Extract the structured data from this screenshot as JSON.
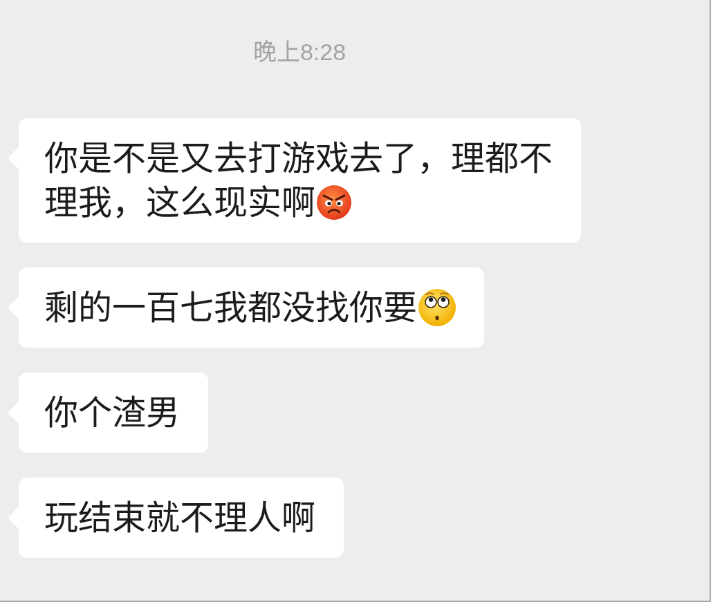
{
  "timestamp": "晚上8:28",
  "messages": [
    {
      "lines": [
        [
          {
            "kind": "text",
            "text": "你是不是又去打游戏去了，理都不"
          }
        ],
        [
          {
            "kind": "text",
            "text": "理我，这么现实啊"
          },
          {
            "kind": "angry_face"
          }
        ]
      ]
    },
    {
      "lines": [
        [
          {
            "kind": "text",
            "text": "剩的一百七我都没找你要"
          },
          {
            "kind": "wide_eyed_face"
          }
        ]
      ]
    },
    {
      "lines": [
        [
          {
            "kind": "text",
            "text": "你个渣男"
          }
        ]
      ]
    },
    {
      "lines": [
        [
          {
            "kind": "text",
            "text": "玩结束就不理人啊"
          }
        ]
      ]
    }
  ]
}
